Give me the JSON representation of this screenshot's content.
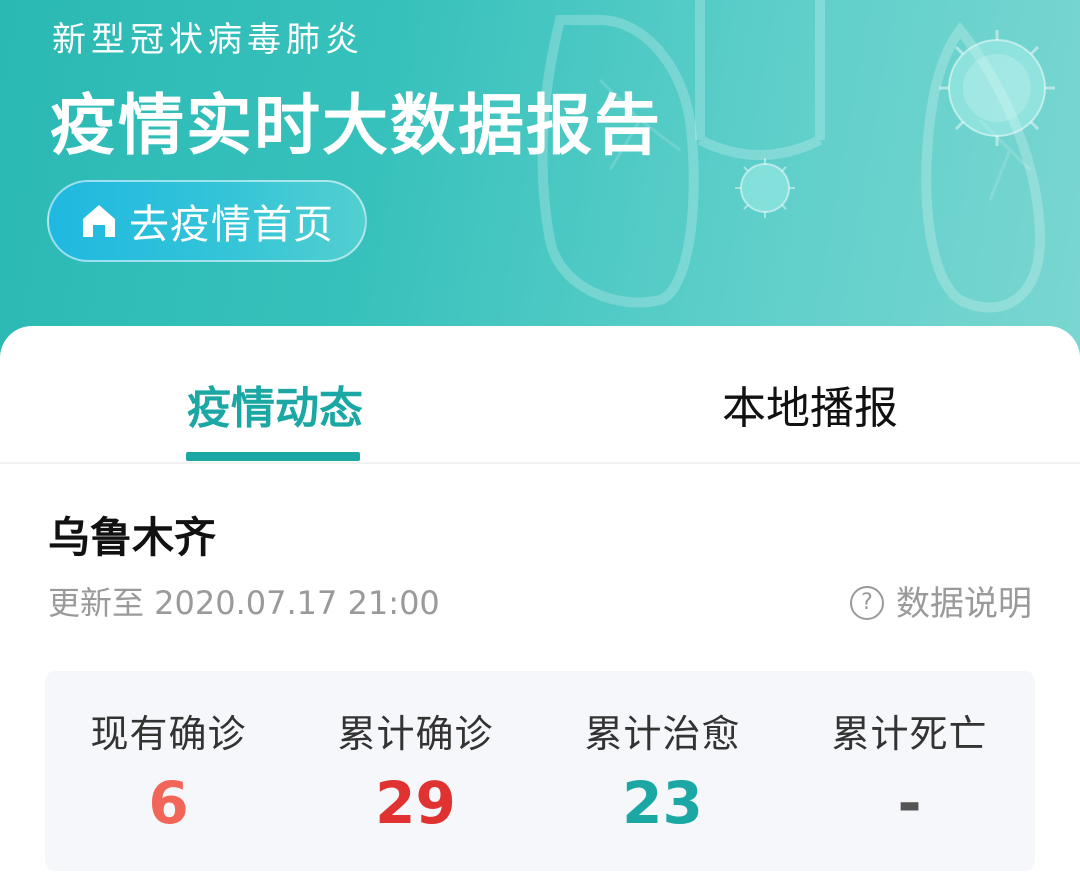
{
  "banner": {
    "subtitle": "新型冠状病毒肺炎",
    "title": "疫情实时大数据报告",
    "home_button": {
      "label": "去疫情首页",
      "icon": "home-icon"
    }
  },
  "tabs": [
    {
      "label": "疫情动态",
      "active": true
    },
    {
      "label": "本地播报",
      "active": false
    }
  ],
  "region": {
    "name": "乌鲁木齐",
    "updated": "更新至 2020.07.17 21:00",
    "explain_label": "数据说明",
    "explain_icon": "question-circle-icon"
  },
  "stats": [
    {
      "label": "现有确诊",
      "value": "6",
      "color": "#f2665a"
    },
    {
      "label": "累计确诊",
      "value": "29",
      "color": "#e13232"
    },
    {
      "label": "累计治愈",
      "value": "23",
      "color": "#1ba8a4"
    },
    {
      "label": "累计死亡",
      "value": "-",
      "color": "#555555"
    }
  ],
  "colors": {
    "accent": "#1ba8a4",
    "banner": "#37c1bc",
    "muted_text": "#9a9a9a"
  }
}
